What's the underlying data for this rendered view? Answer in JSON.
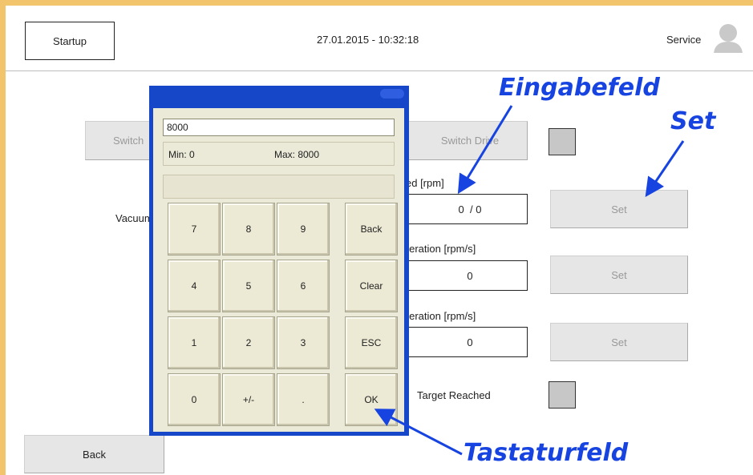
{
  "header": {
    "startup_label": "Startup",
    "datetime": "27.01.2015 - 10:32:18",
    "service_label": "Service"
  },
  "main": {
    "switch_left_label": "Switch",
    "switch_drive_label": "Switch Drive",
    "vacuum_label": "Vacuum",
    "speed_label": "ed [rpm]",
    "speed_value": "0  / 0",
    "acceleration_label": "eleration [rpm/s]",
    "acceleration_value": "0",
    "deceleration_label": "eleration [rpm/s]",
    "deceleration_value": "0",
    "set_label": "Set",
    "target_reached_label": "Target Reached",
    "back_label": "Back"
  },
  "keypad": {
    "input_value": "8000",
    "min_label": "Min: 0",
    "max_label": "Max: 8000",
    "keys": [
      "7",
      "8",
      "9",
      "Back",
      "4",
      "5",
      "6",
      "Clear",
      "1",
      "2",
      "3",
      "ESC",
      "0",
      "+/-",
      ".",
      "OK"
    ]
  },
  "annotations": {
    "eingabefeld": "Eingabefeld",
    "set": "Set",
    "tastaturfeld": "Tastaturfeld"
  },
  "colors": {
    "frame": "#f2c46b",
    "keypad_title": "#1747c9",
    "annotation": "#1744e0"
  }
}
